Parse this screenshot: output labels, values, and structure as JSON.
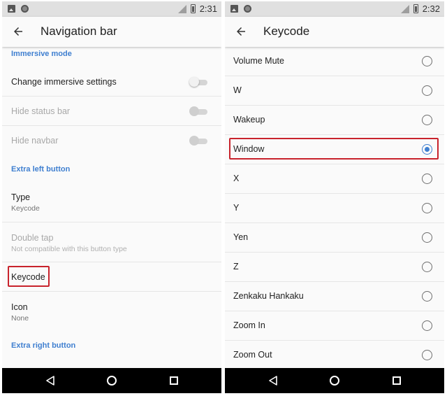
{
  "colors": {
    "accent": "#3f7fd0",
    "highlight": "#c8232c"
  },
  "left": {
    "status": {
      "time": "2:31"
    },
    "toolbar": {
      "title": "Navigation bar"
    },
    "sections": {
      "immersive": "Immersive mode",
      "extra_left": "Extra left button",
      "extra_right": "Extra right button"
    },
    "rows": {
      "change_immersive": "Change immersive settings",
      "hide_status": "Hide status bar",
      "hide_navbar": "Hide navbar",
      "type_title": "Type",
      "type_value": "Keycode",
      "double_tap_title": "Double tap",
      "double_tap_sub": "Not compatible with this button type",
      "keycode_title": "Keycode",
      "icon_title": "Icon",
      "icon_value": "None"
    }
  },
  "right": {
    "status": {
      "time": "2:32"
    },
    "toolbar": {
      "title": "Keycode"
    },
    "options": [
      {
        "label": "Volume Mute",
        "selected": false
      },
      {
        "label": "W",
        "selected": false
      },
      {
        "label": "Wakeup",
        "selected": false
      },
      {
        "label": "Window",
        "selected": true
      },
      {
        "label": "X",
        "selected": false
      },
      {
        "label": "Y",
        "selected": false
      },
      {
        "label": "Yen",
        "selected": false
      },
      {
        "label": "Z",
        "selected": false
      },
      {
        "label": "Zenkaku Hankaku",
        "selected": false
      },
      {
        "label": "Zoom In",
        "selected": false
      },
      {
        "label": "Zoom Out",
        "selected": false
      }
    ]
  },
  "icons": {
    "status_left": [
      "image-icon",
      "circle-icon"
    ],
    "status_right": [
      "no-signal-icon",
      "battery-icon"
    ],
    "toolbar": "arrow-back-icon",
    "navbar": [
      "nav-back-icon",
      "nav-home-icon",
      "nav-recents-icon"
    ]
  }
}
